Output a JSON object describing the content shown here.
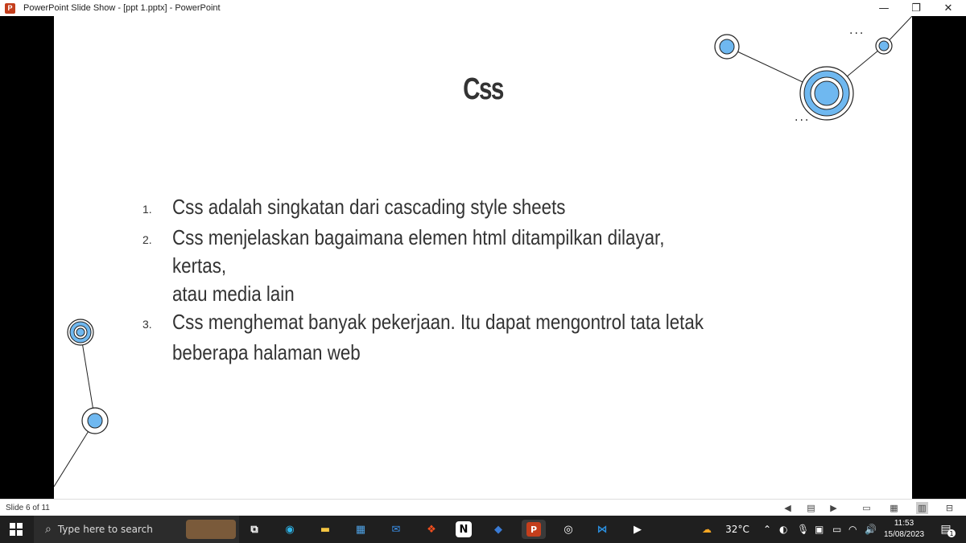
{
  "window": {
    "title": "PowerPoint Slide Show - [ppt 1.pptx] - PowerPoint",
    "app_icon_letter": "P",
    "minimize_glyph": "—",
    "restore_glyph": "❐",
    "close_glyph": "✕"
  },
  "slide": {
    "title": "Css",
    "items": [
      {
        "num": "1.",
        "text": "Css adalah singkatan dari cascading style sheets"
      },
      {
        "num": "2.",
        "text": "Css menjelaskan bagaimana elemen html ditampilkan dilayar, kertas,"
      },
      {
        "num": "",
        "text": "atau media lain"
      },
      {
        "num": "3.",
        "text": "Css menghemat banyak pekerjaan. Itu dapat  mengontrol tata letak"
      },
      {
        "num": "",
        "text": "beberapa halaman web"
      }
    ],
    "dots": "..."
  },
  "statusbar": {
    "slide_counter": "Slide 6 of 11"
  },
  "taskbar": {
    "search_placeholder": "Type here to search",
    "weather": "32°C",
    "time": "11:53",
    "date": "15/08/2023",
    "notification_count": "1"
  },
  "colors": {
    "accent_blue": "#6fb8f0",
    "ring_blue": "#4aa3df",
    "powerpoint": "#c43e1c"
  }
}
